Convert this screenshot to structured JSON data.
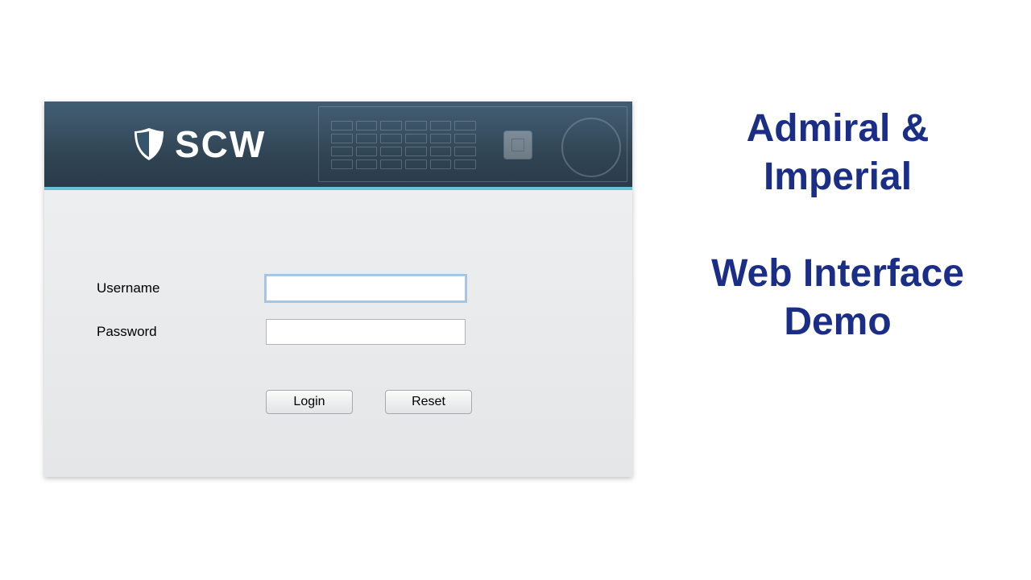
{
  "brand": {
    "name": "SCW"
  },
  "login": {
    "username_label": "Username",
    "password_label": "Password",
    "username_value": "",
    "password_value": "",
    "login_button": "Login",
    "reset_button": "Reset"
  },
  "side_title": {
    "line1": "Admiral &",
    "line2": "Imperial",
    "line3": "Web Interface",
    "line4": "Demo"
  },
  "colors": {
    "title": "#1a2e87",
    "header_accent": "#66c3cf"
  }
}
